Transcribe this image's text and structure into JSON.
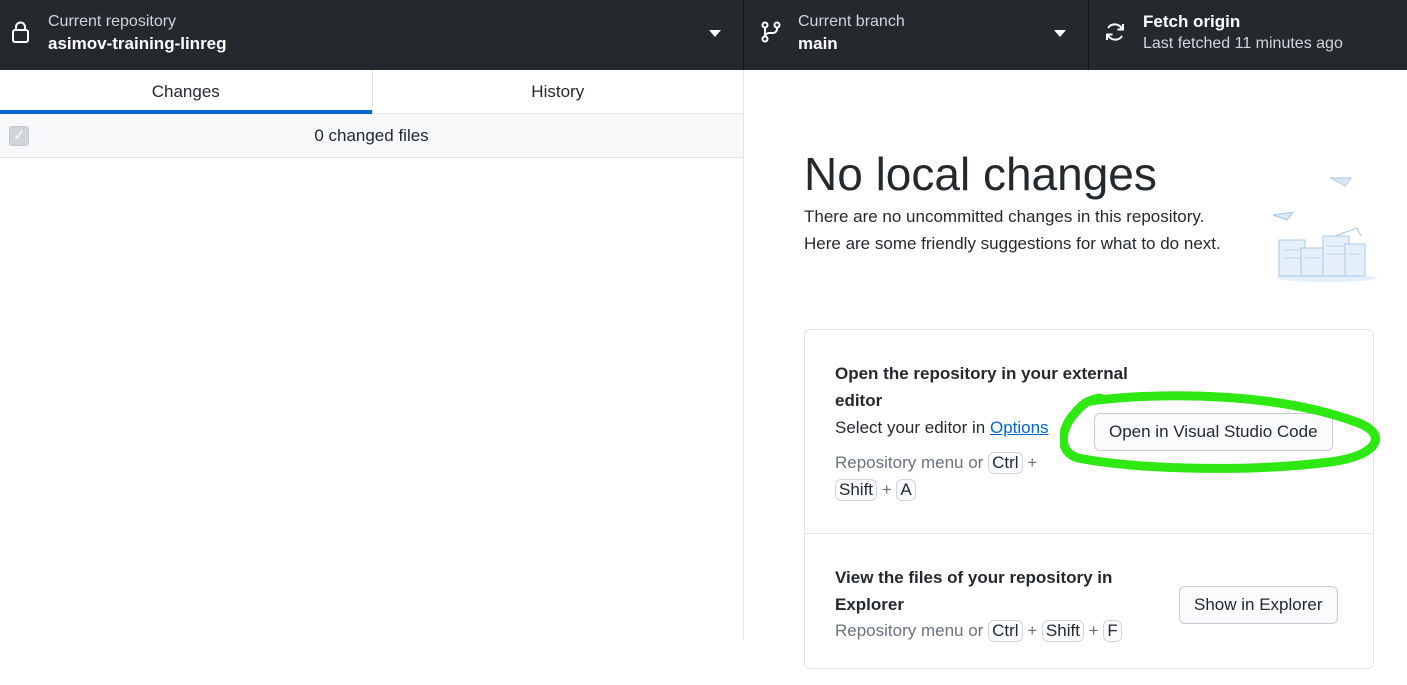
{
  "toolbar": {
    "repo": {
      "label": "Current repository",
      "value": "asimov-training-linreg",
      "icon": "lock-icon"
    },
    "branch": {
      "label": "Current branch",
      "value": "main",
      "icon": "git-branch-icon"
    },
    "fetch": {
      "label": "Fetch origin",
      "status": "Last fetched 11 minutes ago",
      "icon": "sync-icon"
    }
  },
  "tabs": {
    "changes": "Changes",
    "history": "History"
  },
  "changes": {
    "count_label": "0 changed files"
  },
  "blank": {
    "title": "No local changes",
    "description": "There are no uncommitted changes in this repository. Here are some friendly suggestions for what to do next."
  },
  "suggestions": {
    "editor": {
      "title": "Open the repository in your external editor",
      "select_prefix": "Select your editor in ",
      "options_link": "Options",
      "hint_prefix": "Repository menu or ",
      "keys": [
        "Ctrl",
        "Shift",
        "A"
      ],
      "button": "Open in Visual Studio Code"
    },
    "explorer": {
      "title": "View the files of your repository in Explorer",
      "hint_prefix": "Repository menu or ",
      "keys": [
        "Ctrl",
        "Shift",
        "F"
      ],
      "button": "Show in Explorer"
    }
  },
  "colors": {
    "toolbar_bg": "#24292e",
    "accent": "#0366d6",
    "highlight": "#2ee812"
  }
}
